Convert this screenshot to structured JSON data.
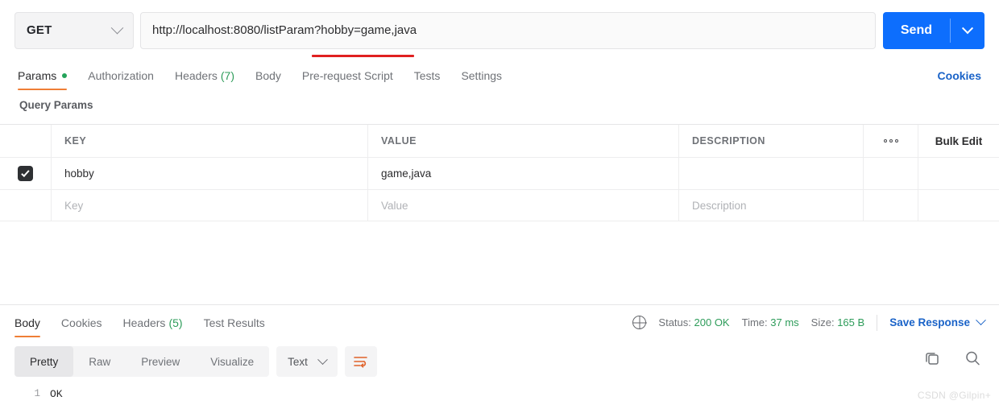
{
  "request": {
    "method": "GET",
    "method_caret_icon": "chevron-down-icon",
    "url": "http://localhost:8080/listParam?hobby=game,java",
    "url_highlight": "hobby=game,java",
    "highlight_color": "#e02020",
    "send_label": "Send",
    "send_caret_icon": "chevron-down-icon",
    "send_color": "#0d6efd"
  },
  "request_tabs": {
    "items": [
      {
        "label": "Params",
        "active": true,
        "has_dot": true
      },
      {
        "label": "Authorization",
        "active": false,
        "has_dot": false
      },
      {
        "label": "Headers",
        "count": "(7)",
        "active": false,
        "has_dot": false
      },
      {
        "label": "Body",
        "active": false,
        "has_dot": false
      },
      {
        "label": "Pre-request Script",
        "active": false,
        "has_dot": false
      },
      {
        "label": "Tests",
        "active": false,
        "has_dot": false
      },
      {
        "label": "Settings",
        "active": false,
        "has_dot": false
      }
    ],
    "cookies_link": "Cookies",
    "active_underline_color": "#ef7e36",
    "dot_color": "#23a35a"
  },
  "query_params": {
    "section_title": "Query Params",
    "columns": {
      "key": "KEY",
      "value": "VALUE",
      "description": "DESCRIPTION",
      "options_icon": "ellipsis-icon",
      "bulk_edit": "Bulk Edit"
    },
    "rows": [
      {
        "checked": true,
        "key": "hobby",
        "value": "game,java",
        "description": ""
      }
    ],
    "placeholder_row": {
      "key": "Key",
      "value": "Value",
      "description": "Description"
    }
  },
  "response": {
    "tabs": [
      {
        "label": "Body",
        "active": true
      },
      {
        "label": "Cookies",
        "active": false
      },
      {
        "label": "Headers",
        "count": "(5)",
        "active": false
      },
      {
        "label": "Test Results",
        "active": false
      }
    ],
    "globe_icon": "globe-icon",
    "status_label": "Status:",
    "status_value": "200 OK",
    "time_label": "Time:",
    "time_value": "37 ms",
    "size_label": "Size:",
    "size_value": "165 B",
    "save_response": "Save Response",
    "save_caret_icon": "chevron-down-icon",
    "meta_value_color": "#2e9c5a",
    "toolbar": {
      "views": [
        {
          "label": "Pretty",
          "active": true
        },
        {
          "label": "Raw",
          "active": false
        },
        {
          "label": "Preview",
          "active": false
        },
        {
          "label": "Visualize",
          "active": false
        }
      ],
      "format": "Text",
      "format_caret_icon": "chevron-down-icon",
      "wrap_icon": "word-wrap-icon",
      "copy_icon": "copy-icon",
      "search_icon": "search-icon"
    },
    "body_lines": [
      {
        "no": "1",
        "text": "OK"
      }
    ]
  },
  "watermark": "CSDN @Gilpin+"
}
